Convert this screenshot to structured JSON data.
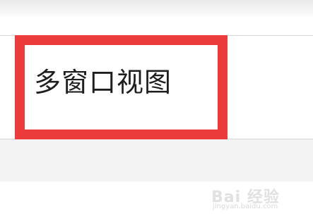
{
  "menu": {
    "item_label": "多窗口视图"
  },
  "highlight": {
    "color": "#ec3b3b"
  },
  "watermark": {
    "brand": "Bai 经验",
    "url": "jingyan.baidu.com"
  }
}
